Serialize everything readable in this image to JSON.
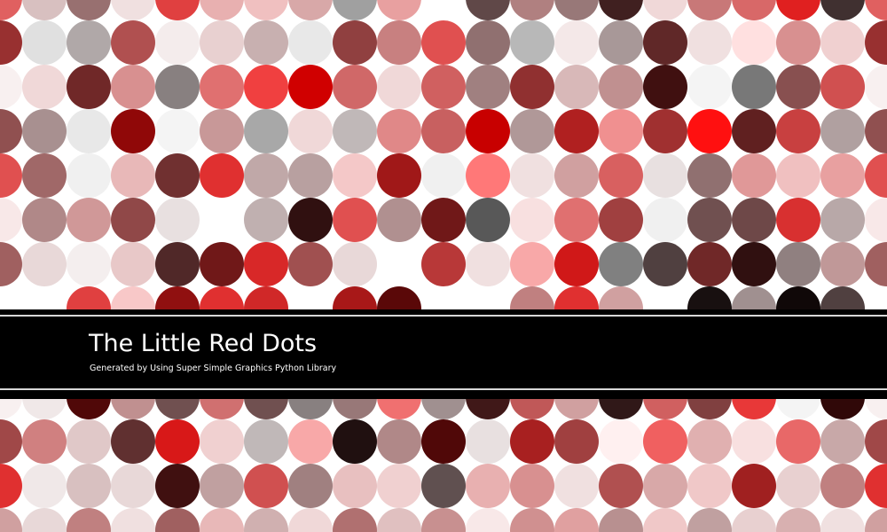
{
  "banner": {
    "title": "The Little Red Dots",
    "subtitle": "Generated by Using Super Simple Graphics Python Library",
    "background_color": "#000000",
    "rule_color": "#d8d8d8",
    "text_color": "#ffffff"
  },
  "dot_grid": {
    "columns": 21,
    "rows": 13,
    "palette": [
      "#e06060",
      "#d8c0c0",
      "#987070",
      "#f0e0e0",
      "#e04040",
      "#e8b0b0",
      "#f0c0c0",
      "#d8a8a8",
      "#a0a0a0",
      "#e8a0a0",
      "#ffffff",
      "#604848",
      "#b08080",
      "#987878",
      "#402020",
      "#f0d8d8",
      "#c87878",
      "#d86868",
      "#c03838",
      "#403030",
      "#983030",
      "#e0e0e0",
      "#b0a8a8",
      "#b05050",
      "#f4ecec",
      "#e8d0d0",
      "#c8b0b0",
      "#e8e8e8",
      "#904040",
      "#c88080",
      "#e05050",
      "#907070",
      "#b8b8b8",
      "#f4e8e8",
      "#a89898",
      "#602828",
      "#f0e0e0",
      "#ffe0e0",
      "#d89090",
      "#f0d0d0",
      "#f8f0f0",
      "#f0d8d8",
      "#702828",
      "#d89090",
      "#888080",
      "#e07070",
      "#f04040",
      "#d00000",
      "#d06868",
      "#f0d8d8",
      "#d06060",
      "#a08080",
      "#903030",
      "#d8b8b8",
      "#c09090",
      "#401010",
      "#f4f4f4",
      "#787878",
      "#885050",
      "#d05050",
      "#905050",
      "#a89090",
      "#e8e8e8",
      "#900808",
      "#f4f4f4",
      "#c89898",
      "#a8a8a8",
      "#f0d8d8",
      "#c0b8b8",
      "#e08888",
      "#c86060",
      "#c80000",
      "#b09898",
      "#b02020",
      "#f09090",
      "#a03030",
      "#ff1010",
      "#602020",
      "#c84040",
      "#b0a0a0",
      "#e05050",
      "#a06868",
      "#f0f0f0",
      "#e8b8b8",
      "#703030",
      "#e03030",
      "#c0a8a8",
      "#b8a0a0",
      "#f4c8c8",
      "#a01818",
      "#f0f0f0",
      "#ff7878",
      "#f0e0e0",
      "#d0a0a0",
      "#d86060",
      "#e8e0e0",
      "#907070",
      "#e09898",
      "#f0c0c0",
      "#e8a0a0",
      "#f8e8e8",
      "#b08888",
      "#d09898",
      "#904848",
      "#e8e0e0",
      "#ffffff",
      "#c0b0b0",
      "#301010",
      "#e05050",
      "#b09090",
      "#701818",
      "#585858",
      "#f8e0e0",
      "#e07070",
      "#a04040",
      "#f0f0f0",
      "#705050",
      "#6e4848",
      "#d83030",
      "#b8a8a8",
      "#a06060",
      "#e8d8d8",
      "#f4eeee",
      "#e8c8c8",
      "#502828",
      "#701818",
      "#d82828",
      "#a05050",
      "#e8d8d8",
      "#ffffff",
      "#b83838",
      "#f0e0e0",
      "#f8a8a8",
      "#d01818",
      "#808080",
      "#504040",
      "#702828",
      "#301010",
      "#908080",
      "#c09898",
      "#ffffff",
      "#ffffff",
      "#e04040",
      "#f8c8c8",
      "#901010",
      "#e03030",
      "#d02828",
      "#ffffff",
      "#a81818",
      "#5a0808",
      "#ffffff",
      "#ffffff",
      "#c08080",
      "#e03030",
      "#d0a0a0",
      "#ffffff",
      "#181010",
      "#a09090",
      "#100808",
      "#504040",
      "#e08888",
      "#c08888",
      "#502020",
      "#d0a8a8",
      "#e06060",
      "#b03030",
      "#a08080",
      "#f4b0b0",
      "#e0a0a0",
      "#e86060",
      "#501010",
      "#c05050",
      "#f04040",
      "#ff1010",
      "#c88080",
      "#d8c0c0",
      "#e8d0d0",
      "#f0e0e0",
      "#c0c0c0",
      "#e8a0a0",
      "#f8f0f0",
      "#f0e8e8",
      "#500808",
      "#c09090",
      "#705050",
      "#d07070",
      "#705050",
      "#888080",
      "#987878",
      "#f07070",
      "#a09090",
      "#401818",
      "#c05858",
      "#d0a0a0",
      "#301818",
      "#d06060",
      "#804040",
      "#e83838",
      "#f4f4f4",
      "#300808",
      "#a04848",
      "#d08080",
      "#e0c8c8",
      "#603030",
      "#d81818",
      "#f0d0d0",
      "#c0b8b8",
      "#f8a8a8",
      "#201010",
      "#b08888",
      "#500808",
      "#e8e0e0",
      "#a82020",
      "#a04040",
      "#fff0f0",
      "#f06060",
      "#e0b0b0",
      "#f8e0e0",
      "#e86868",
      "#c8a8a8",
      "#f0e8e8",
      "#e8c0c0",
      "#f0d0d0",
      "#d8a0a0",
      "#e8c8c8",
      "#f8e0e0",
      "#e0a8a8",
      "#f0e0e0",
      "#d89898",
      "#f8f0f0",
      "#e0b8b8",
      "#f0d8d8",
      "#e8b0b0",
      "#ffffff",
      "#e0c0c0",
      "#f0e8e8",
      "#d8a8a8",
      "#f8e8e8",
      "#e8b8b8",
      "#f0d0d0",
      "#d0a0a0",
      "#e8d8d8",
      "#c08080",
      "#f0e0e0",
      "#a06060",
      "#e8b8b8",
      "#d0b0b0",
      "#f0d8d8",
      "#b07070",
      "#e0c0c0",
      "#c89090",
      "#f8e8e8",
      "#d09090",
      "#e0a0a0",
      "#b89090",
      "#f0c8c8",
      "#c0a0a0",
      "#e8d0d0",
      "#d8b0b0",
      "#f0e0e0"
    ],
    "fill_colors_by_cell": [
      "#e06060",
      "#d8c0c0",
      "#987070",
      "#f0e0e0",
      "#e04040",
      "#e8b0b0",
      "#f0c0c0",
      "#d8a8a8",
      "#a0a0a0",
      "#e8a0a0",
      "#ffffff",
      "#604848",
      "#b08080",
      "#987878",
      "#402020",
      "#f0d8d8",
      "#c87878",
      "#d86868",
      "#e02020",
      "#403030",
      "#e06060",
      "#983030",
      "#e0e0e0",
      "#b0a8a8",
      "#b05050",
      "#f4ecec",
      "#e8d0d0",
      "#c8b0b0",
      "#e8e8e8",
      "#904040",
      "#c88080",
      "#e05050",
      "#907070",
      "#b8b8b8",
      "#f4e8e8",
      "#a89898",
      "#602828",
      "#f0e0e0",
      "#ffe0e0",
      "#d89090",
      "#f0d0d0",
      "#983030",
      "#f8f0f0",
      "#f0d8d8",
      "#702828",
      "#d89090",
      "#888080",
      "#e07070",
      "#f04040",
      "#d00000",
      "#d06868",
      "#f0d8d8",
      "#d06060",
      "#a08080",
      "#903030",
      "#d8b8b8",
      "#c09090",
      "#401010",
      "#f4f4f4",
      "#787878",
      "#885050",
      "#d05050",
      "#f8f0f0",
      "#905050",
      "#a89090",
      "#e8e8e8",
      "#900808",
      "#f4f4f4",
      "#c89898",
      "#a8a8a8",
      "#f0d8d8",
      "#c0b8b8",
      "#e08888",
      "#c86060",
      "#c80000",
      "#b09898",
      "#b02020",
      "#f09090",
      "#a03030",
      "#ff1010",
      "#602020",
      "#c84040",
      "#b0a0a0",
      "#905050",
      "#e05050",
      "#a06868",
      "#f0f0f0",
      "#e8b8b8",
      "#703030",
      "#e03030",
      "#c0a8a8",
      "#b8a0a0",
      "#f4c8c8",
      "#a01818",
      "#f0f0f0",
      "#ff7878",
      "#f0e0e0",
      "#d0a0a0",
      "#d86060",
      "#e8e0e0",
      "#907070",
      "#e09898",
      "#f0c0c0",
      "#e8a0a0",
      "#e05050",
      "#f8e8e8",
      "#b08888",
      "#d09898",
      "#904848",
      "#e8e0e0",
      "#ffffff",
      "#c0b0b0",
      "#301010",
      "#e05050",
      "#b09090",
      "#701818",
      "#585858",
      "#f8e0e0",
      "#e07070",
      "#a04040",
      "#f0f0f0",
      "#705050",
      "#6e4848",
      "#d83030",
      "#b8a8a8",
      "#f8e8e8",
      "#a06060",
      "#e8d8d8",
      "#f4eeee",
      "#e8c8c8",
      "#502828",
      "#701818",
      "#d82828",
      "#a05050",
      "#e8d8d8",
      "#ffffff",
      "#b83838",
      "#f0e0e0",
      "#f8a8a8",
      "#d01818",
      "#808080",
      "#504040",
      "#702828",
      "#301010",
      "#908080",
      "#c09898",
      "#a06060",
      "#ffffff",
      "#ffffff",
      "#e04040",
      "#f8c8c8",
      "#901010",
      "#e03030",
      "#d02828",
      "#ffffff",
      "#a81818",
      "#5a0808",
      "#ffffff",
      "#ffffff",
      "#c08080",
      "#e03030",
      "#d0a0a0",
      "#ffffff",
      "#181010",
      "#a09090",
      "#100808",
      "#504040",
      "#ffffff",
      "#e08888",
      "#c08888",
      "#502020",
      "#d0a8a8",
      "#e06060",
      "#b03030",
      "#a08080",
      "#f4b0b0",
      "#e0a0a0",
      "#e86060",
      "#501010",
      "#c05050",
      "#f04040",
      "#ff1010",
      "#c88080",
      "#d8c0c0",
      "#e8d0d0",
      "#f0e0e0",
      "#c0c0c0",
      "#e8a0a0",
      "#e08888",
      "#f8f0f0",
      "#f0e8e8",
      "#500808",
      "#c09090",
      "#705050",
      "#d07070",
      "#705050",
      "#888080",
      "#987878",
      "#f07070",
      "#a09090",
      "#401818",
      "#c05858",
      "#d0a0a0",
      "#301818",
      "#d06060",
      "#804040",
      "#e83838",
      "#f4f4f4",
      "#300808",
      "#f8f0f0",
      "#a04848",
      "#d08080",
      "#e0c8c8",
      "#603030",
      "#d81818",
      "#f0d0d0",
      "#c0b8b8",
      "#f8a8a8",
      "#201010",
      "#b08888",
      "#500808",
      "#e8e0e0",
      "#a82020",
      "#a04040",
      "#fff0f0",
      "#f06060",
      "#e0b0b0",
      "#f8e0e0",
      "#e86868",
      "#c8a8a8",
      "#a04848",
      "#e03030",
      "#f0e8e8",
      "#d8c0c0",
      "#e8d8d8",
      "#401010",
      "#c0a0a0",
      "#d05050",
      "#a08080",
      "#e8c0c0",
      "#f0d0d0",
      "#605050",
      "#e8b0b0",
      "#d89090",
      "#f0e0e0",
      "#b05050",
      "#d8a8a8",
      "#f0c8c8",
      "#a02020",
      "#e8d0d0",
      "#c08080",
      "#e03030",
      "#d0a0a0",
      "#e8d8d8",
      "#c08080",
      "#f0e0e0",
      "#a06060",
      "#e8b8b8",
      "#d0b0b0",
      "#f0d8d8",
      "#b07070",
      "#e0c0c0",
      "#c89090",
      "#f8e8e8",
      "#d09090",
      "#e0a0a0",
      "#b89090",
      "#f0c8c8",
      "#c0a0a0",
      "#e8d0d0",
      "#d8b0b0",
      "#f0e0e0",
      "#d0a0a0"
    ]
  }
}
